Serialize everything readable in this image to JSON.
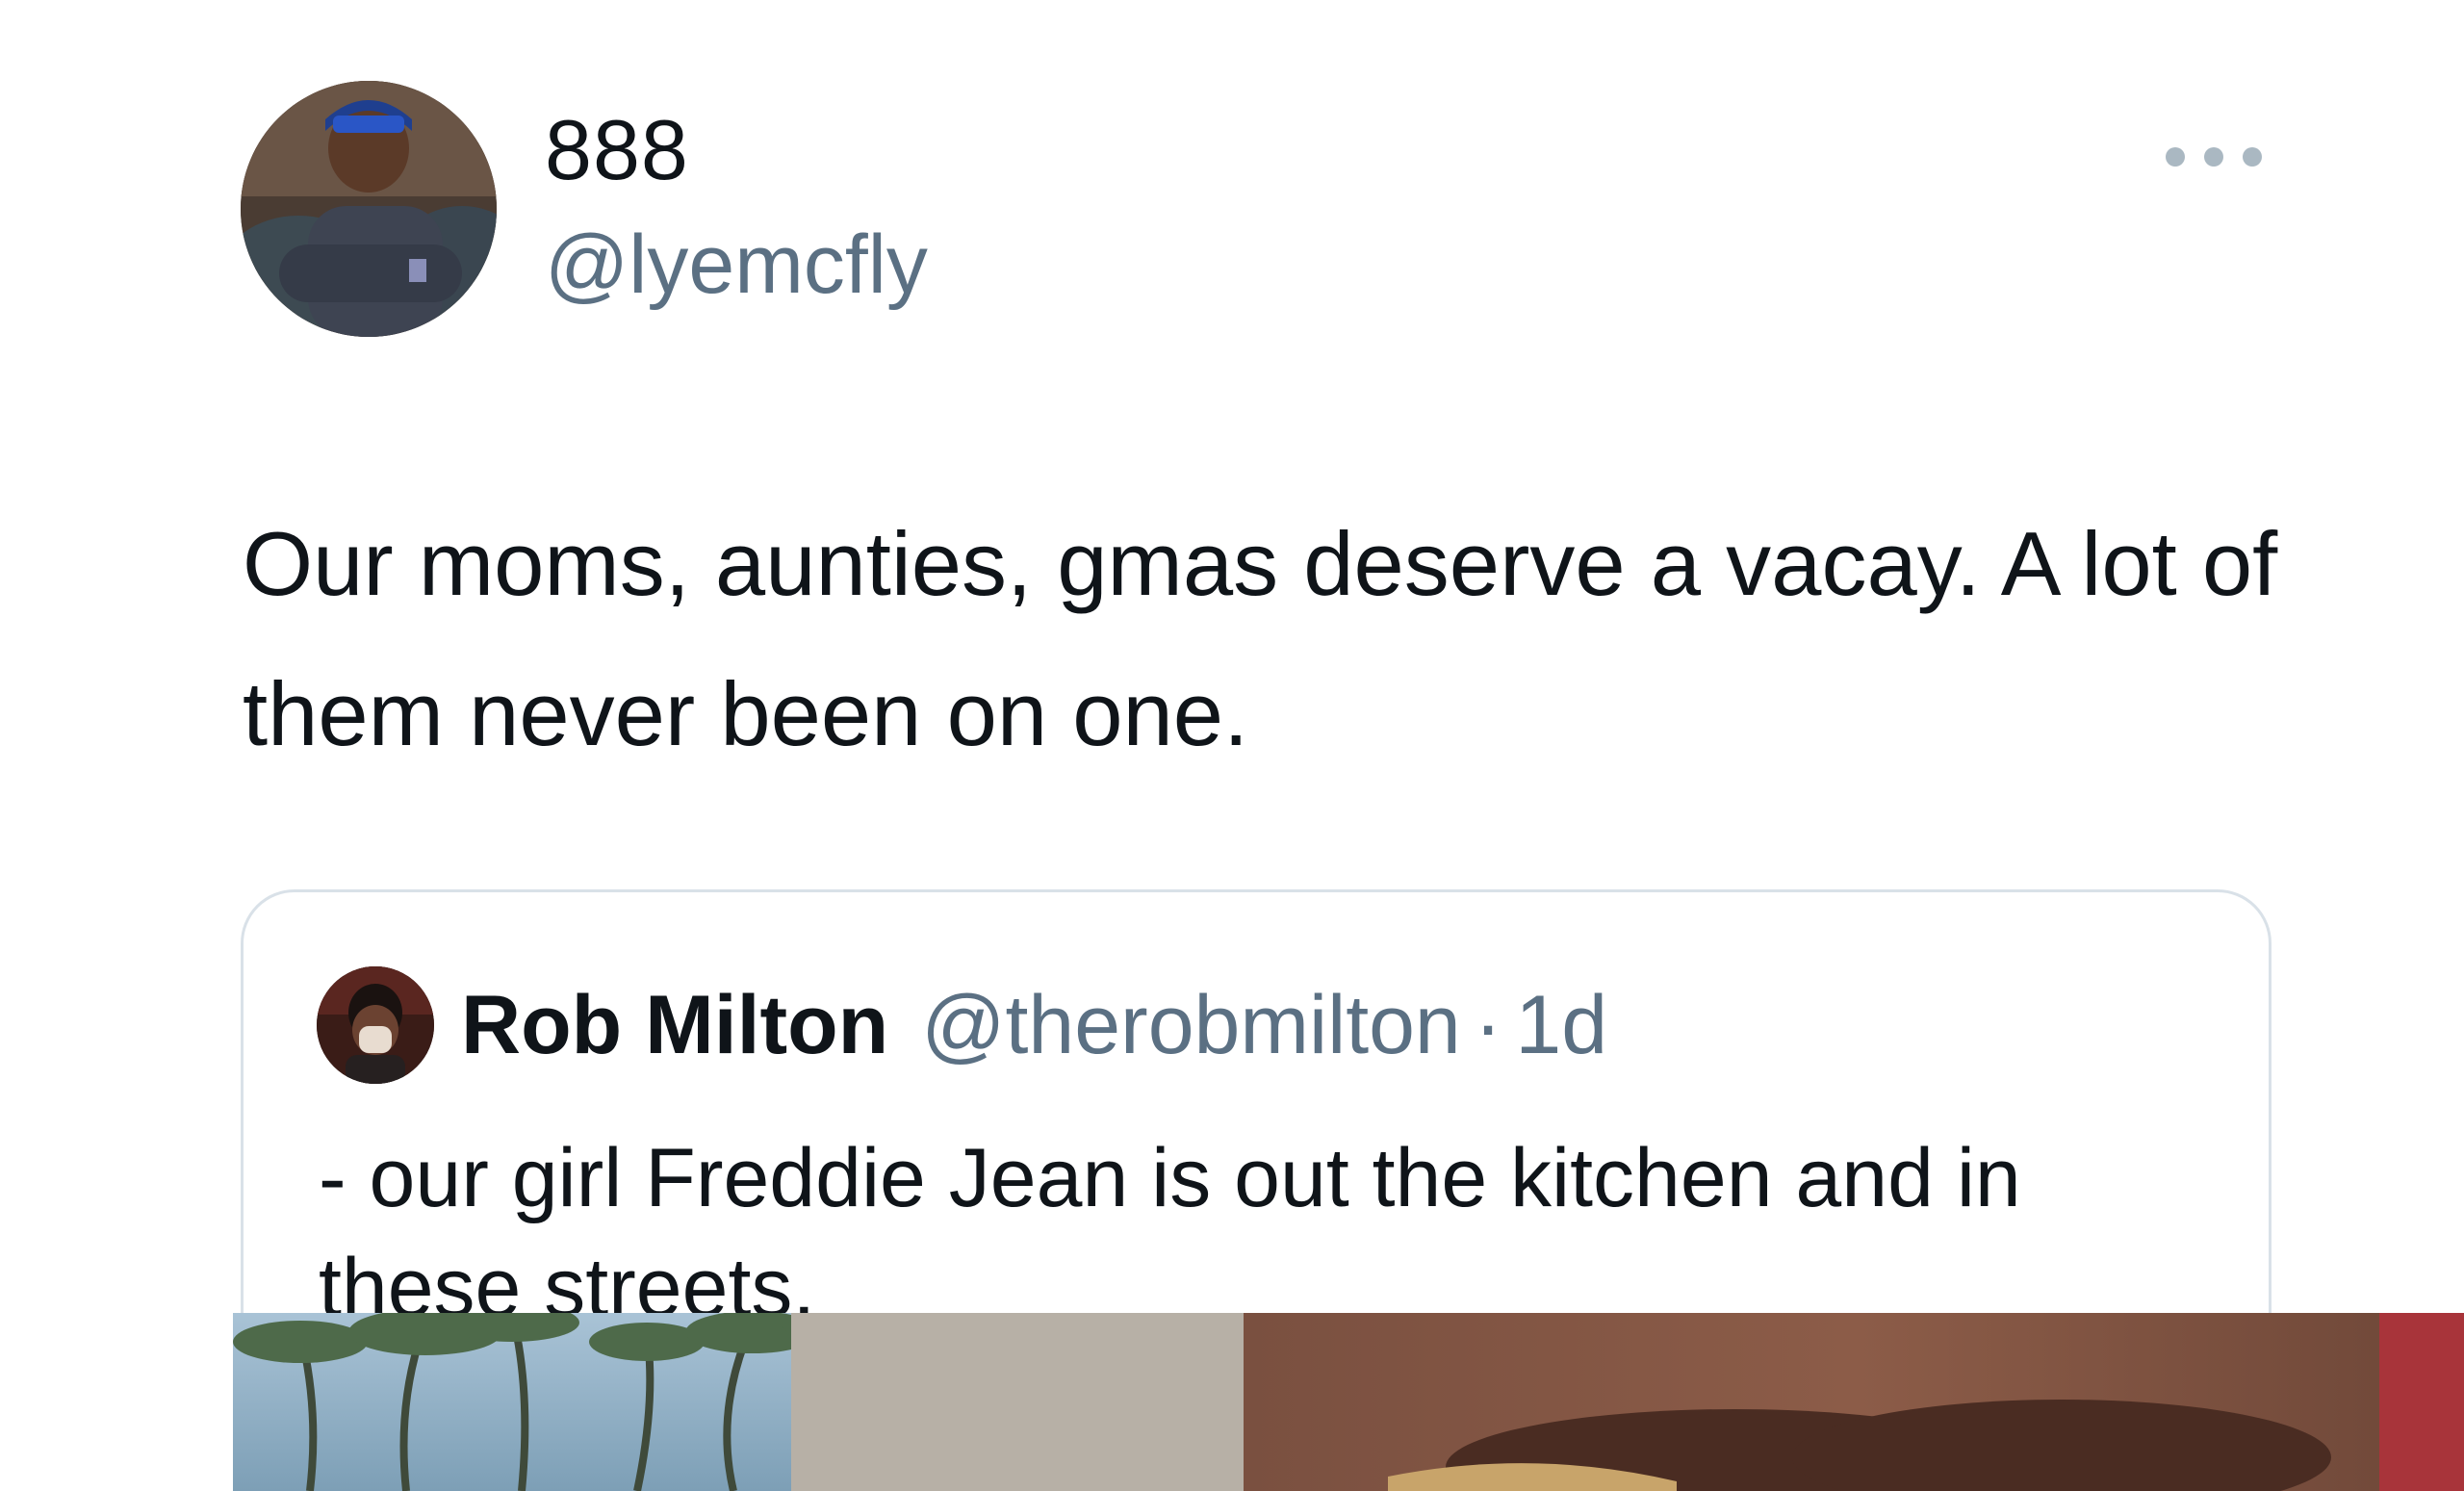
{
  "author": {
    "display_name": "888",
    "handle": "@lyemcfly",
    "avatar_icon": "profile-photo-avatar"
  },
  "more_icon": "more-dots-icon",
  "tweet": {
    "text": "Our moms, aunties, gmas deserve a vacay. A lot of them never been on one."
  },
  "quoted_tweet": {
    "author_name": "Rob Milton",
    "author_handle": "@therobmilton",
    "separator": "·",
    "time": "1d",
    "text": "- our girl Freddie Jean is out the kitchen and in these streets.",
    "avatar_icon": "profile-photo-avatar"
  },
  "colors": {
    "primary_text": "#0f1419",
    "secondary_text": "#5b7083",
    "border": "#d9e1e8",
    "more_dots": "#aab8c2"
  }
}
